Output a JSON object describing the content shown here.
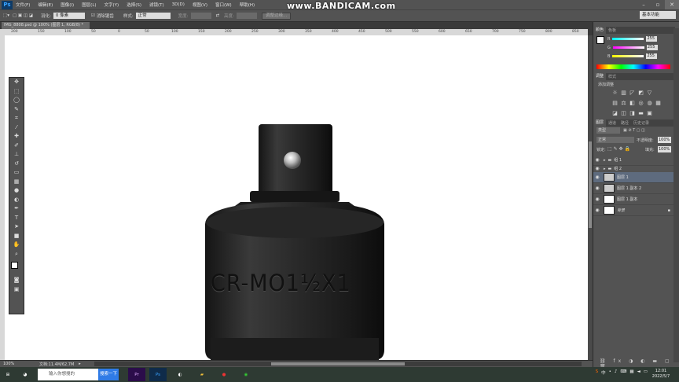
{
  "app": {
    "logo": "Ps",
    "watermark": "www.BANDICAM.com"
  },
  "menu": [
    "文件(F)",
    "编辑(E)",
    "图像(I)",
    "图层(L)",
    "文字(Y)",
    "选择(S)",
    "滤镜(T)",
    "3D(D)",
    "视图(V)",
    "窗口(W)",
    "帮助(H)"
  ],
  "options": {
    "feather_label": "羽化:",
    "feather_value": "0 像素",
    "antialias_label": "消除锯齿",
    "style_label": "样式:",
    "style_value": "正常",
    "width_label": "宽度:",
    "height_label": "高度:",
    "refine_edge": "调整边缘...",
    "workspace": "基本功能"
  },
  "document": {
    "tab": "IMG_8808.psd @ 100% (图层 1, RGB/8) *",
    "engraving": "CR-MO1½X1",
    "zoom": "100%",
    "doc_info": "文档:11.4M/62.7M",
    "ruler_marks": [
      "200",
      "150",
      "100",
      "50",
      "0",
      "50",
      "100",
      "150",
      "200",
      "250",
      "300",
      "350",
      "400",
      "450",
      "500",
      "550",
      "600",
      "650",
      "700",
      "750",
      "800",
      "850",
      "900"
    ]
  },
  "tools": [
    "move-icon",
    "marquee-icon",
    "lasso-icon",
    "quick-select-icon",
    "crop-icon",
    "eyedropper-icon",
    "healing-icon",
    "brush-icon",
    "stamp-icon",
    "history-brush-icon",
    "eraser-icon",
    "gradient-icon",
    "blur-icon",
    "dodge-icon",
    "pen-icon",
    "type-icon",
    "path-select-icon",
    "shape-icon",
    "hand-icon",
    "zoom-icon"
  ],
  "color_panel": {
    "tabs": [
      "颜色",
      "色板"
    ],
    "channels": [
      {
        "label": "R",
        "value": "255",
        "color": "#d94a4a"
      },
      {
        "label": "G",
        "value": "255",
        "color": "#4ad94a"
      },
      {
        "label": "B",
        "value": "255",
        "color": "#4a6ad9"
      }
    ]
  },
  "adjust_panel": {
    "tabs": [
      "调整",
      "样式"
    ],
    "title": "添加调整"
  },
  "layers_panel": {
    "tabs": [
      "图层",
      "通道",
      "路径",
      "历史记录"
    ],
    "filter": "类型",
    "blend": "正常",
    "opacity_label": "不透明度:",
    "opacity": "100%",
    "lock_label": "锁定:",
    "fill_label": "填充:",
    "fill": "100%",
    "layers": [
      {
        "name": "组 1",
        "kind": "group"
      },
      {
        "name": "组 2",
        "kind": "group"
      },
      {
        "name": "图层 1",
        "kind": "layer",
        "selected": true
      },
      {
        "name": "图层 1 副本 2",
        "kind": "layer"
      },
      {
        "name": "图层 1 副本",
        "kind": "layer"
      },
      {
        "name": "背景",
        "kind": "background"
      }
    ]
  },
  "taskbar": {
    "search_placeholder": "输入你想搜的",
    "search_button": "搜索一下",
    "clock_time": "12:01",
    "clock_date": "2022/5/7"
  },
  "colors": {
    "ui": "#535353",
    "canvas": "#ffffff",
    "selected_layer": "#5e6b7e"
  }
}
